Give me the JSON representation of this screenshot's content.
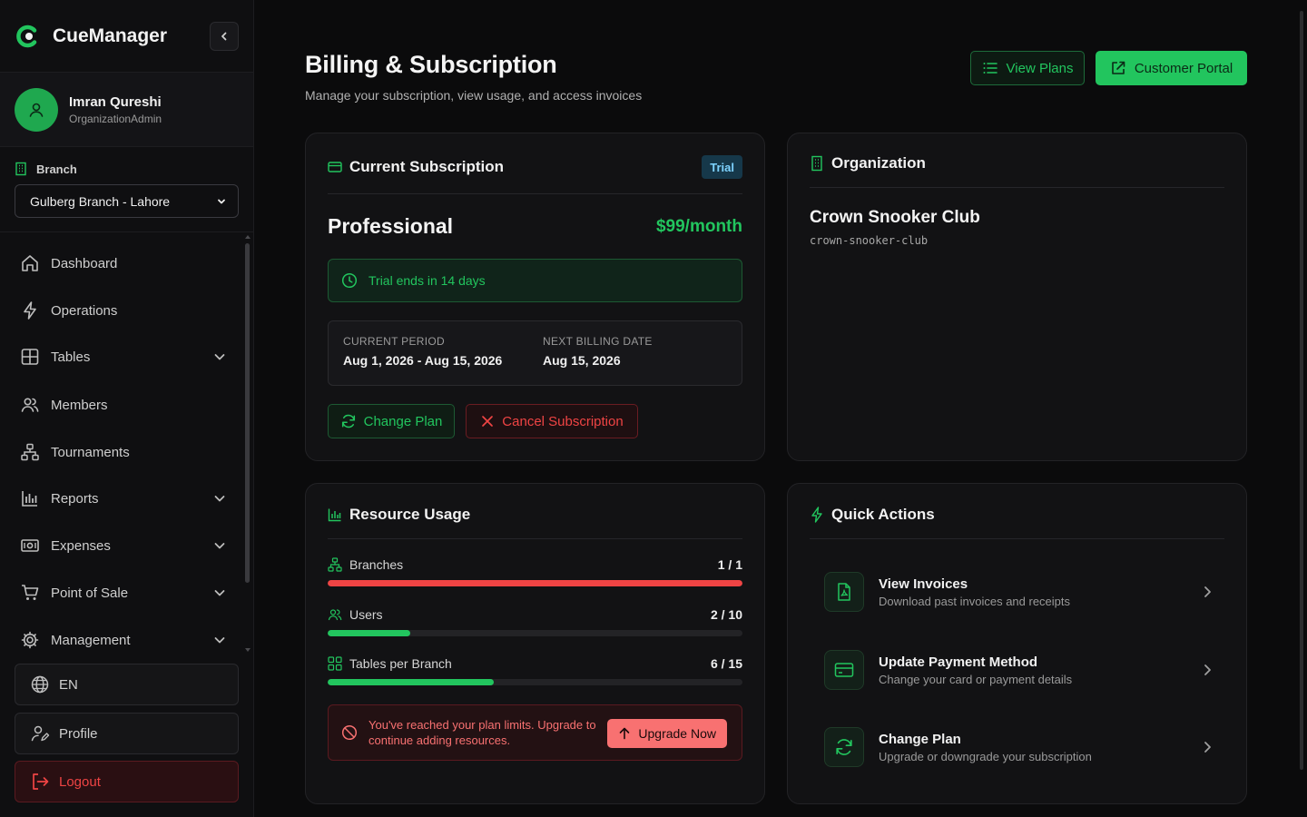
{
  "app": {
    "name": "CueManager"
  },
  "user": {
    "name": "Imran Qureshi",
    "role": "OrganizationAdmin"
  },
  "branch": {
    "label": "Branch",
    "selected": "Gulberg Branch - Lahore"
  },
  "nav": [
    {
      "label": "Dashboard",
      "icon": "home-icon",
      "has_children": false
    },
    {
      "label": "Operations",
      "icon": "bolt-icon",
      "has_children": false
    },
    {
      "label": "Tables",
      "icon": "grid-icon",
      "has_children": true
    },
    {
      "label": "Members",
      "icon": "users-icon",
      "has_children": false
    },
    {
      "label": "Tournaments",
      "icon": "bracket-icon",
      "has_children": false
    },
    {
      "label": "Reports",
      "icon": "bar-chart-icon",
      "has_children": true
    },
    {
      "label": "Expenses",
      "icon": "banknote-icon",
      "has_children": true
    },
    {
      "label": "Point of Sale",
      "icon": "cart-icon",
      "has_children": true
    },
    {
      "label": "Management",
      "icon": "gear-icon",
      "has_children": true
    }
  ],
  "footer": {
    "language": "EN",
    "profile": "Profile",
    "logout": "Logout"
  },
  "header": {
    "title": "Billing & Subscription",
    "subtitle": "Manage your subscription, view usage, and access invoices",
    "view_plans": "View Plans",
    "customer_portal": "Customer Portal"
  },
  "subscription": {
    "title": "Current Subscription",
    "badge": "Trial",
    "plan": "Professional",
    "price": "$99/month",
    "trial_notice": "Trial ends in 14 days",
    "period_label": "CURRENT PERIOD",
    "period_value": "Aug 1, 2026 - Aug 15, 2026",
    "next_label": "NEXT BILLING DATE",
    "next_value": "Aug 15, 2026",
    "change_plan": "Change Plan",
    "cancel": "Cancel Subscription"
  },
  "organization": {
    "title": "Organization",
    "name": "Crown Snooker Club",
    "slug": "crown-snooker-club"
  },
  "usage": {
    "title": "Resource Usage",
    "items": [
      {
        "label": "Branches",
        "value": "1 / 1",
        "fraction": 1.0,
        "at_limit": true
      },
      {
        "label": "Users",
        "value": "2 / 10",
        "fraction": 0.2,
        "at_limit": false
      },
      {
        "label": "Tables per Branch",
        "value": "6 / 15",
        "fraction": 0.4,
        "at_limit": false
      }
    ],
    "limit_message": "You've reached your plan limits. Upgrade to continue adding resources.",
    "upgrade": "Upgrade Now"
  },
  "quick_actions": {
    "title": "Quick Actions",
    "items": [
      {
        "title": "View Invoices",
        "desc": "Download past invoices and receipts",
        "icon": "invoice-icon"
      },
      {
        "title": "Update Payment Method",
        "desc": "Change your card or payment details",
        "icon": "card-icon"
      },
      {
        "title": "Change Plan",
        "desc": "Upgrade or downgrade your subscription",
        "icon": "refresh-icon"
      }
    ]
  },
  "colors": {
    "accent": "#22c55e",
    "danger": "#ef4444",
    "trial": "#7ed3ff",
    "background": "#0b0b0c"
  }
}
